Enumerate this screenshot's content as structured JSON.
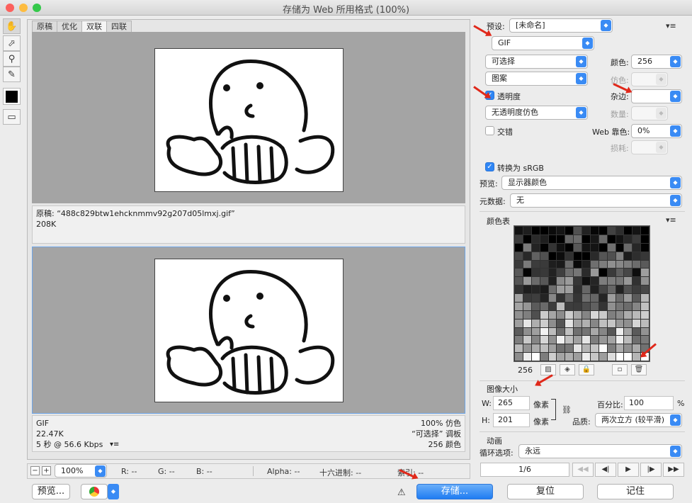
{
  "window": {
    "title": "存储为 Web 所用格式 (100%)"
  },
  "tabs": [
    "原稿",
    "优化",
    "双联",
    "四联"
  ],
  "original": {
    "filename": "原稿: “488c829btw1ehcknmmv92g207d05lmxj.gif”",
    "size": "208K"
  },
  "optimized": {
    "format": "GIF",
    "size": "22.47K",
    "speed": "5 秒 @ 56.6 Kbps",
    "dither": "100% 仿色",
    "palette": "“可选择” 调板",
    "colors": "256 颜色"
  },
  "statusbar": {
    "zoom": "100%",
    "r": "R: --",
    "g": "G: --",
    "b": "B: --",
    "alpha": "Alpha: --",
    "hex": "十六进制: --",
    "index": "索引: --"
  },
  "bottom": {
    "preview": "预览...",
    "save": "存储...",
    "reset": "复位",
    "remember": "记住"
  },
  "settings": {
    "preset_label": "预设:",
    "preset_value": "[未命名]",
    "format": "GIF",
    "reduction": "可选择",
    "dither_algo": "图案",
    "transparency_label": "透明度",
    "transparency_dither": "无透明度仿色",
    "interlaced_label": "交错",
    "colors_label": "颜色:",
    "colors_value": "256",
    "dither_label": "仿色:",
    "matte_label": "杂边:",
    "amount_label": "数量:",
    "websnap_label": "Web 靠色:",
    "websnap_value": "0%",
    "lossy_label": "损耗:",
    "convert_srgb": "转换为 sRGB",
    "preview_label": "预览:",
    "preview_value": "显示器颜色",
    "metadata_label": "元数据:",
    "metadata_value": "无",
    "color_table_label": "颜色表",
    "color_count": "256"
  },
  "image_size": {
    "label": "图像大小",
    "w_label": "W:",
    "w_value": "265",
    "w_unit": "像素",
    "h_label": "H:",
    "h_value": "201",
    "h_unit": "像素",
    "percent_label": "百分比:",
    "percent_value": "100",
    "percent_unit": "%",
    "quality_label": "品质:",
    "quality_value": "两次立方 (较平滑)"
  },
  "animation": {
    "label": "动画",
    "loop_label": "循环选项:",
    "loop_value": "永远",
    "frame": "1/6"
  },
  "colors": {
    "accent": "#2f86f5",
    "arrow": "#e0281a",
    "canvas_gray": "#a4a4a4"
  }
}
